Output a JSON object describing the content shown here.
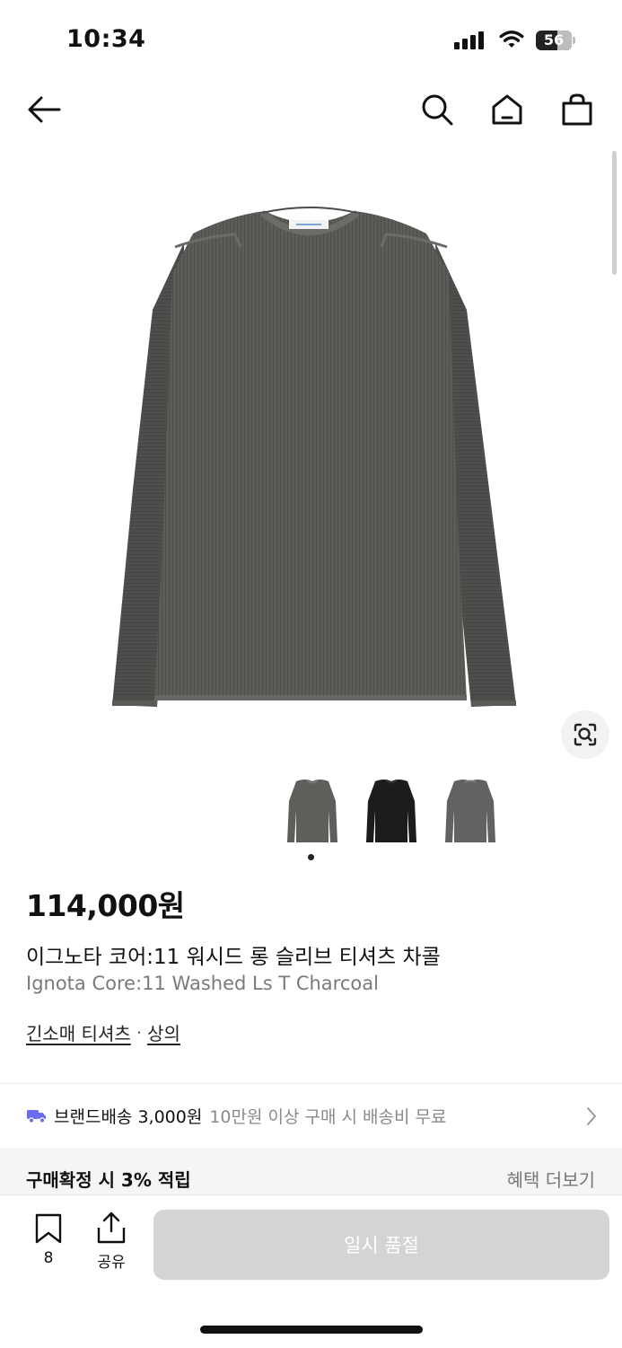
{
  "status_bar": {
    "time": "10:34",
    "battery": "56"
  },
  "nav": {
    "back_icon": "arrow-left",
    "search_icon": "search",
    "home_icon": "home",
    "cart_icon": "shopping-bag"
  },
  "gallery": {
    "thumbnails": [
      "charcoal",
      "black",
      "charcoal-back"
    ],
    "active_index": 0
  },
  "product": {
    "price": "114,000원",
    "name_ko": "이그노타 코어:11 워시드 롱 슬리브 티셔츠 차콜",
    "name_en": "Ignota Core:11 Washed Ls T Charcoal",
    "category_main": "긴소매 티셔츠",
    "category_separator": "·",
    "category_parent": "상의"
  },
  "delivery": {
    "main": "브랜드배송 3,000원",
    "sub": "10만원 이상 구매 시 배송비 무료"
  },
  "points": {
    "label": "구매확정 시 3% 적립",
    "more": "혜택 더보기"
  },
  "bottom": {
    "bookmark_count": "8",
    "share_label": "공유",
    "soldout_label": "일시 품절"
  },
  "colors": {
    "sweater": "#5b5d59",
    "sweater_dark": "#4b4d4a",
    "delivery_accent": "#6b6bf0",
    "button_disabled": "#d4d4d4"
  }
}
